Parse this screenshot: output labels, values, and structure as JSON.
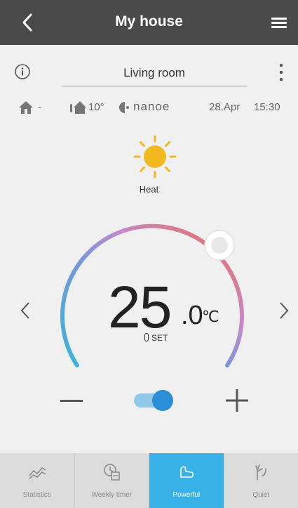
{
  "header": {
    "title": "My house",
    "back_icon": "chevron-left-icon",
    "menu_icon": "hamburger-menu-icon"
  },
  "room": {
    "name": "Living room"
  },
  "status": {
    "indoor": "-",
    "outdoor": "10°",
    "nanoe": "nanoe",
    "date": "28.Apr",
    "time": "15:30"
  },
  "mode": {
    "label": "Heat",
    "icon": "sun-icon",
    "color": "#f2b91e"
  },
  "setpoint": {
    "integer": "25",
    "decimal": ".0",
    "unit": "℃",
    "label": "SET"
  },
  "toggle": {
    "state": "on"
  },
  "tabs": [
    {
      "label": "Statistics",
      "icon": "statistics-icon",
      "active": false
    },
    {
      "label": "Weekly timer",
      "icon": "weekly-timer-icon",
      "active": false
    },
    {
      "label": "Powerful",
      "icon": "powerful-icon",
      "active": true
    },
    {
      "label": "Quiet",
      "icon": "quiet-icon",
      "active": false
    }
  ],
  "colors": {
    "header": "#4a4a4a",
    "active_tab": "#38b1e8",
    "toggle_on": "#2a8fd6"
  }
}
